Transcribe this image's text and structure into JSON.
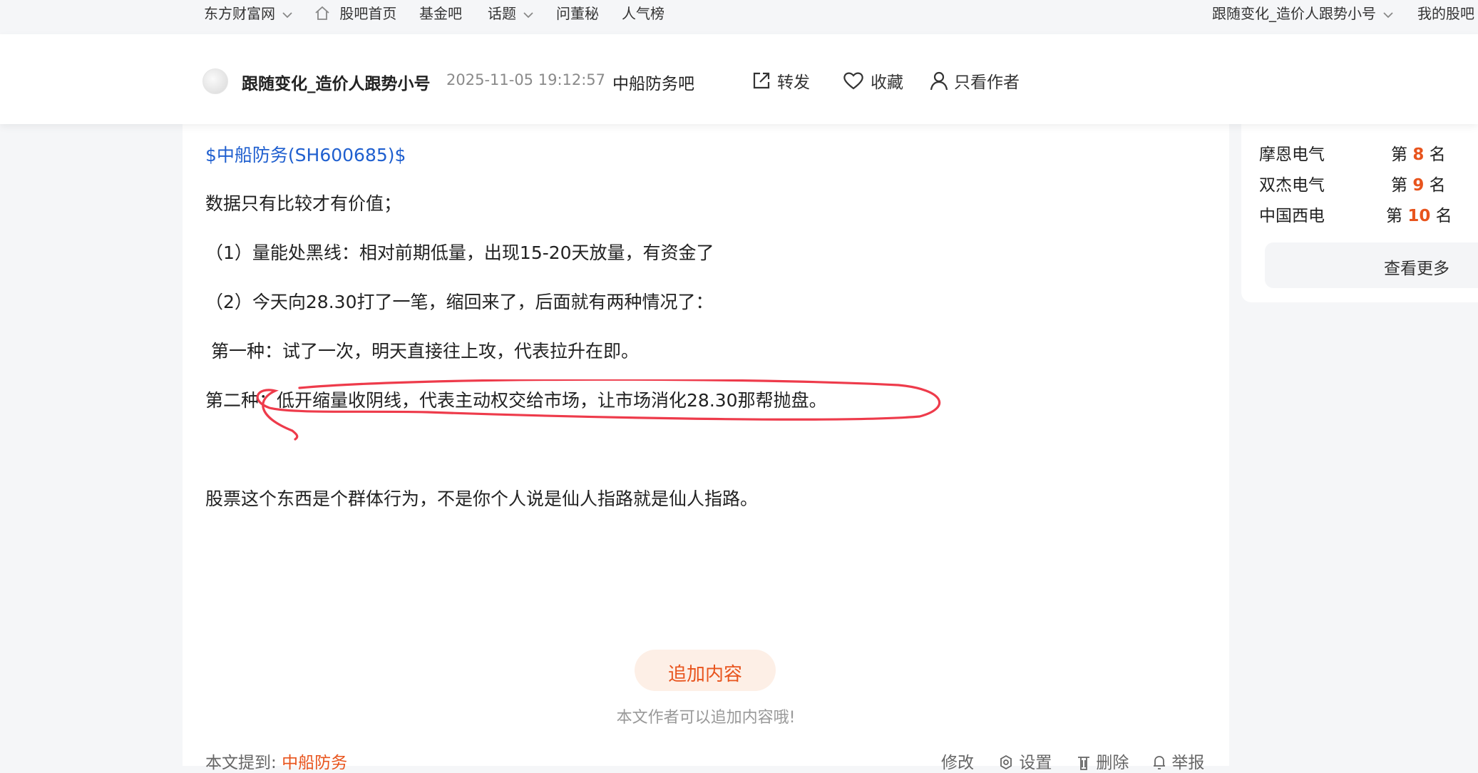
{
  "topnav": {
    "site": "东方财富网",
    "home": "股吧首页",
    "fund": "基金吧",
    "topics": "话题",
    "ask": "问董秘",
    "popular": "人气榜",
    "user": "跟随变化_造价人跟势小号",
    "mybar": "我的股吧"
  },
  "post": {
    "author": "跟随变化_造价人跟势小号",
    "time": "2025-11-05 19:12:57",
    "bar": "中船防务吧",
    "actions": {
      "forward": "转发",
      "favorite": "收藏",
      "author_only": "只看作者"
    },
    "stock_tag": "$中船防务(SH600685)$",
    "lines": [
      "数据只有比较才有价值；",
      "（1）量能处黑线：相对前期低量，出现15-20天放量，有资金了",
      "（2）今天向28.30打了一笔，缩回来了，后面就有两种情况了：",
      " 第一种：试了一次，明天直接往上攻，代表拉升在即。",
      "第二种：低开缩量收阴线，代表主动权交给市场，让市场消化28.30那帮抛盘。",
      "股票这个东西是个群体行为，不是你个人说是仙人指路就是仙人指路。"
    ],
    "add_content": "追加内容",
    "add_hint": "本文作者可以追加内容哦!",
    "mentioned_label": "本文提到:",
    "mentioned_stock": "中船防务",
    "footer": {
      "edit": "修改",
      "settings": "设置",
      "delete": "删除",
      "report": "举报"
    }
  },
  "sidebar": {
    "ranks": [
      {
        "name": "摩恩电气",
        "prefix": "第",
        "num": "8",
        "suffix": "名"
      },
      {
        "name": "双杰电气",
        "prefix": "第",
        "num": "9",
        "suffix": "名"
      },
      {
        "name": "中国西电",
        "prefix": "第",
        "num": "10",
        "suffix": "名"
      }
    ],
    "more": "查看更多"
  },
  "colors": {
    "accent": "#e8541d",
    "link": "#1f5fcf",
    "annotation": "#ee3b4b"
  }
}
